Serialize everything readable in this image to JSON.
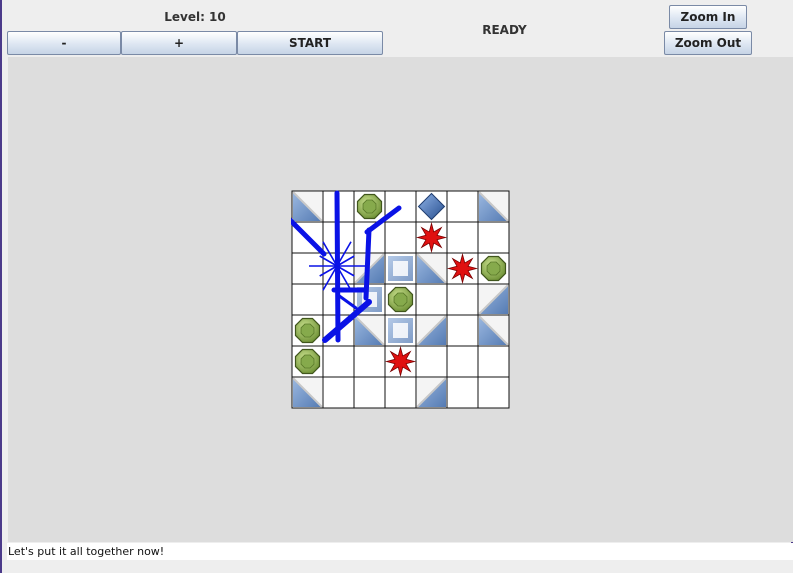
{
  "toolbar": {
    "level_label": "Level: 10",
    "minus_label": "-",
    "plus_label": "+",
    "start_label": "START",
    "status_text": "READY",
    "zoom_in_label": "Zoom In",
    "zoom_out_label": "Zoom Out"
  },
  "board": {
    "cols": 7,
    "rows": 7,
    "mirrors": [
      {
        "row": 0,
        "col": 0,
        "orientation": "backslash"
      },
      {
        "row": 0,
        "col": 6,
        "orientation": "backslash"
      },
      {
        "row": 2,
        "col": 2,
        "orientation": "slash"
      },
      {
        "row": 2,
        "col": 3,
        "orientation": "block"
      },
      {
        "row": 2,
        "col": 4,
        "orientation": "backslash"
      },
      {
        "row": 3,
        "col": 2,
        "orientation": "block"
      },
      {
        "row": 3,
        "col": 6,
        "orientation": "slash"
      },
      {
        "row": 4,
        "col": 2,
        "orientation": "backslash"
      },
      {
        "row": 4,
        "col": 3,
        "orientation": "block"
      },
      {
        "row": 4,
        "col": 4,
        "orientation": "slash"
      },
      {
        "row": 4,
        "col": 6,
        "orientation": "backslash"
      },
      {
        "row": 6,
        "col": 0,
        "orientation": "backslash"
      },
      {
        "row": 6,
        "col": 4,
        "orientation": "slash"
      }
    ],
    "green_gems": [
      {
        "row": 0,
        "col": 2
      },
      {
        "row": 2,
        "col": 6
      },
      {
        "row": 3,
        "col": 3
      },
      {
        "row": 4,
        "col": 0
      },
      {
        "row": 5,
        "col": 0
      }
    ],
    "red_stars": [
      {
        "row": 1,
        "col": 4
      },
      {
        "row": 2,
        "col": 5
      },
      {
        "row": 5,
        "col": 3
      }
    ],
    "blue_diamonds": [
      {
        "row": 0,
        "col": 4
      }
    ]
  },
  "colors": {
    "laser": "#0a12e6",
    "mirror": "#6f94c8",
    "gem": "#86aa4c",
    "star": "#e01010",
    "diamond": "#3f70b6"
  },
  "footer": {
    "status_message": "Let's put it all together now!"
  }
}
